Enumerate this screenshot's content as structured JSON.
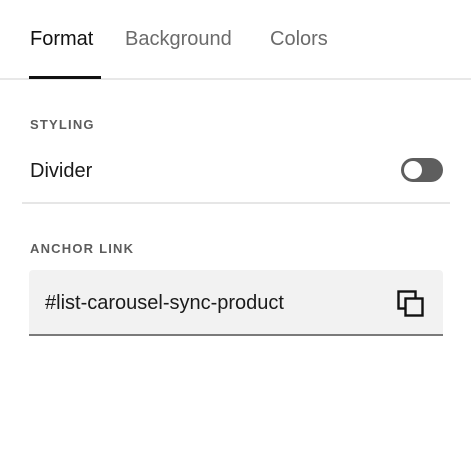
{
  "tabs": [
    {
      "label": "Format",
      "active": true
    },
    {
      "label": "Background",
      "active": false
    },
    {
      "label": "Colors",
      "active": false
    }
  ],
  "styling": {
    "section_label": "STYLING",
    "divider_label": "Divider",
    "divider_enabled": false
  },
  "anchor": {
    "section_label": "ANCHOR LINK",
    "value": "#list-carousel-sync-product",
    "copy_icon": "copy-icon"
  },
  "colors": {
    "active_tab": "#111111",
    "inactive_tab": "#6b6b6b",
    "toggle_off": "#5e5e5e",
    "field_bg": "#f2f2f2"
  }
}
